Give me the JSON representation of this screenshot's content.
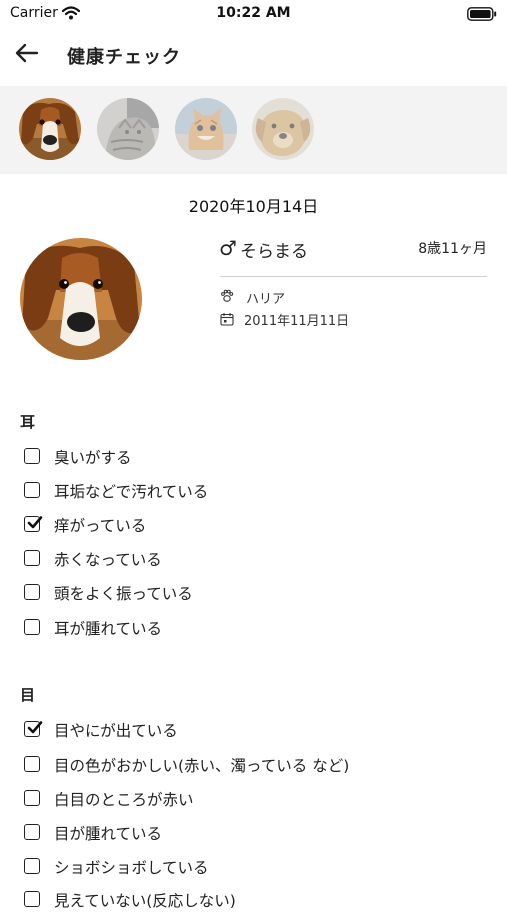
{
  "status_bar": {
    "carrier": "Carrier",
    "time": "10:22 AM"
  },
  "nav": {
    "title": "健康チェック"
  },
  "pets": [
    {
      "name": "beagle",
      "selected": true
    },
    {
      "name": "tabby-cat",
      "selected": false
    },
    {
      "name": "kitten",
      "selected": false
    },
    {
      "name": "golden-puppy",
      "selected": false
    }
  ],
  "date": "2020年10月14日",
  "profile": {
    "gender_symbol": "♂",
    "name": "そらまる",
    "age": "8歳11ヶ月",
    "breed": "ハリア",
    "birthdate": "2011年11月11日"
  },
  "sections": [
    {
      "title": "耳",
      "items": [
        {
          "label": "臭いがする",
          "checked": false
        },
        {
          "label": "耳垢などで汚れている",
          "checked": false
        },
        {
          "label": "痒がっている",
          "checked": true
        },
        {
          "label": "赤くなっている",
          "checked": false
        },
        {
          "label": "頭をよく振っている",
          "checked": false
        },
        {
          "label": "耳が腫れている",
          "checked": false
        }
      ]
    },
    {
      "title": "目",
      "items": [
        {
          "label": "目やにが出ている",
          "checked": true
        },
        {
          "label": "目の色がおかしい(赤い、濁っている など)",
          "checked": false
        },
        {
          "label": "白目のところが赤い",
          "checked": false
        },
        {
          "label": "目が腫れている",
          "checked": false
        },
        {
          "label": "ショボショボしている",
          "checked": false
        },
        {
          "label": "見えていない(反応しない)",
          "checked": false
        }
      ]
    }
  ]
}
